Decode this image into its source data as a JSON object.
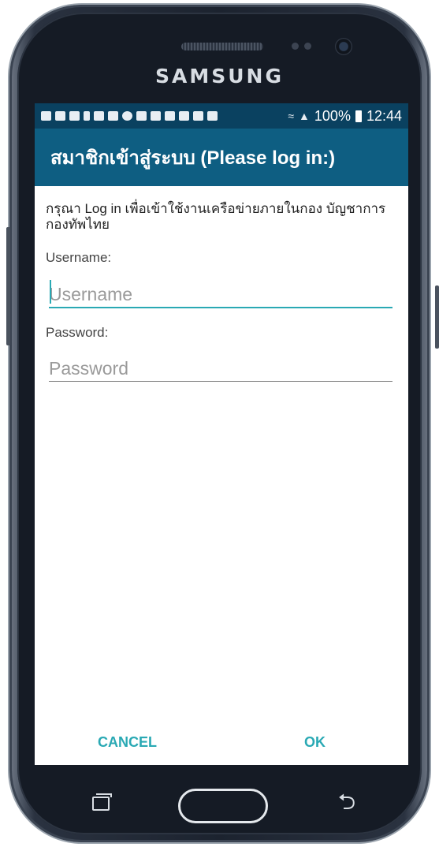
{
  "device": {
    "brand": "SAMSUNG"
  },
  "status_bar": {
    "notification_icons": [
      "chat-icon",
      "photo-icon",
      "photo-icon",
      "person-icon",
      "gallery-icon",
      "app-icon",
      "app-icon",
      "app-icon",
      "grid-icon",
      "mail-icon",
      "drive-icon",
      "bag-icon",
      "bag-icon"
    ],
    "wifi_icon": "wifi-icon",
    "signal_icon": "signal-icon",
    "battery": "100%",
    "time": "12:44"
  },
  "dialog": {
    "title": "สมาชิกเข้าสู่ระบบ (Please log in:)",
    "description": "กรุณา Log in เพื่อเข้าใช้งานเครือข่ายภายในกอง บัญชาการกองทัพไทย",
    "username_label": "Username:",
    "username_placeholder": "Username",
    "username_value": "",
    "password_label": "Password:",
    "password_placeholder": "Password",
    "password_value": "",
    "cancel_label": "CANCEL",
    "ok_label": "OK"
  },
  "nav_buttons": {
    "recent_icon": "recent-apps-icon",
    "home_icon": "home-button",
    "back_icon": "back-arrow-icon",
    "back_glyph": "⮌"
  },
  "colors": {
    "status_bar": "#0a4160",
    "app_bar": "#0e5e82",
    "accent": "#2aa9b4"
  }
}
